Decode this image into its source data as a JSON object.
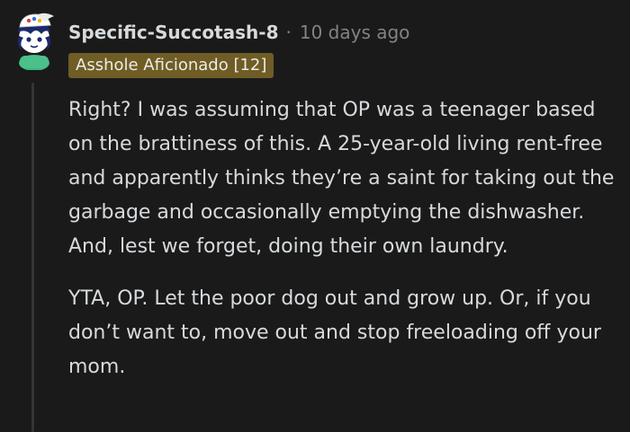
{
  "comment": {
    "author": "Specific-Succotash-8",
    "separator": "·",
    "timestamp": "10 days ago",
    "flair": "Asshole Aficionado [12]",
    "paragraphs": [
      "Right? I was assuming that OP was a teenager based on the brattiness of this. A 25-year-old living rent-free and apparently thinks they’re a saint for taking out the garbage and occasionally emptying the dishwasher. And, lest we forget, doing their own laundry.",
      "YTA, OP. Let the poor dog out and grow up. Or, if you don’t want to, move out and stop freeloading off your mom."
    ]
  },
  "colors": {
    "background": "#1a1a1b",
    "text": "#d7dadc",
    "meta": "#818384",
    "flair_bg": "#6f5d25",
    "thread_line": "#343536"
  },
  "icons": {
    "avatar": "snoo-avatar-icon"
  }
}
